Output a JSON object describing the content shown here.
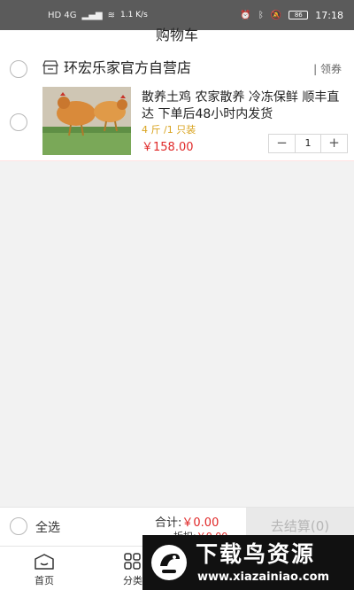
{
  "status_bar": {
    "network": "HD 4G",
    "speed": "1.1 K/s",
    "battery": "86",
    "time": "17:18"
  },
  "page": {
    "title": "购物车"
  },
  "store": {
    "name": "环宏乐家官方自营店",
    "coupon_label": "领券"
  },
  "item": {
    "title": "散养土鸡 农家散养 冷冻保鲜 顺丰直达 下单后48小时内发货",
    "spec": "4 斤 /1 只装",
    "price": "￥158.00",
    "quantity": "1",
    "minus": "−",
    "plus": "+"
  },
  "footer": {
    "select_all": "全选",
    "total_label": "合计:",
    "total_value": "￥0.00",
    "discount_label": "折扣:",
    "discount_value": "￥0.00",
    "checkout": "去结算(0)"
  },
  "tabs": [
    {
      "label": "首页",
      "icon": "home-icon"
    },
    {
      "label": "分类",
      "icon": "category-icon"
    }
  ],
  "watermark": {
    "title": "下载鸟资源",
    "url": "www.xiazainiao.com"
  }
}
